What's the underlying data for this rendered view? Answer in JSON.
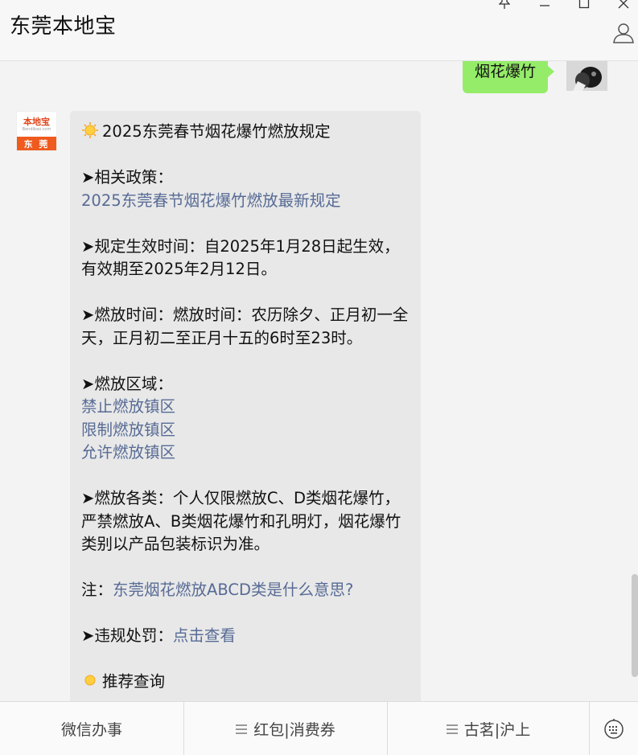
{
  "window": {
    "title": "东莞本地宝"
  },
  "chat": {
    "outgoing": {
      "text": "烟花爆竹"
    },
    "bot_avatar": {
      "logo_text": "本地宝",
      "logo_sub": "Bendibao.com",
      "city": "东 莞"
    },
    "incoming": {
      "heading": "2025东莞春节烟花爆竹燃放规定",
      "policy_label": "➤相关政策：",
      "policy_link": "2025东莞春节烟花爆竹燃放最新规定",
      "effective": "➤规定生效时间：自2025年1月28日起生效，有效期至2025年2月12日。",
      "time": "➤燃放时间：燃放时间：农历除夕、正月初一全天，正月初二至正月十五的6时至23时。",
      "area_label": "➤燃放区域：",
      "area_links": [
        "禁止燃放镇区",
        "限制燃放镇区",
        "允许燃放镇区"
      ],
      "types": "➤燃放各类：个人仅限燃放C、D类烟花爆竹，严禁燃放A、B类烟花爆竹和孔明灯，烟花爆竹类别以产品包装标识为准。",
      "note_label": "注：",
      "note_link": "东莞烟花燃放ABCD类是什么意思?",
      "penalty_label": "➤违规处罚：",
      "penalty_link": "点击查看",
      "recommend": "推荐查询"
    }
  },
  "bottom_menu": {
    "items": [
      "微信办事",
      "红包|消费券",
      "古茗|沪上"
    ]
  },
  "colors": {
    "outgoing_bubble": "#95ec69",
    "incoming_bubble": "#e8e8e8",
    "link": "#576b95",
    "logo_orange": "#ef5a1e"
  }
}
